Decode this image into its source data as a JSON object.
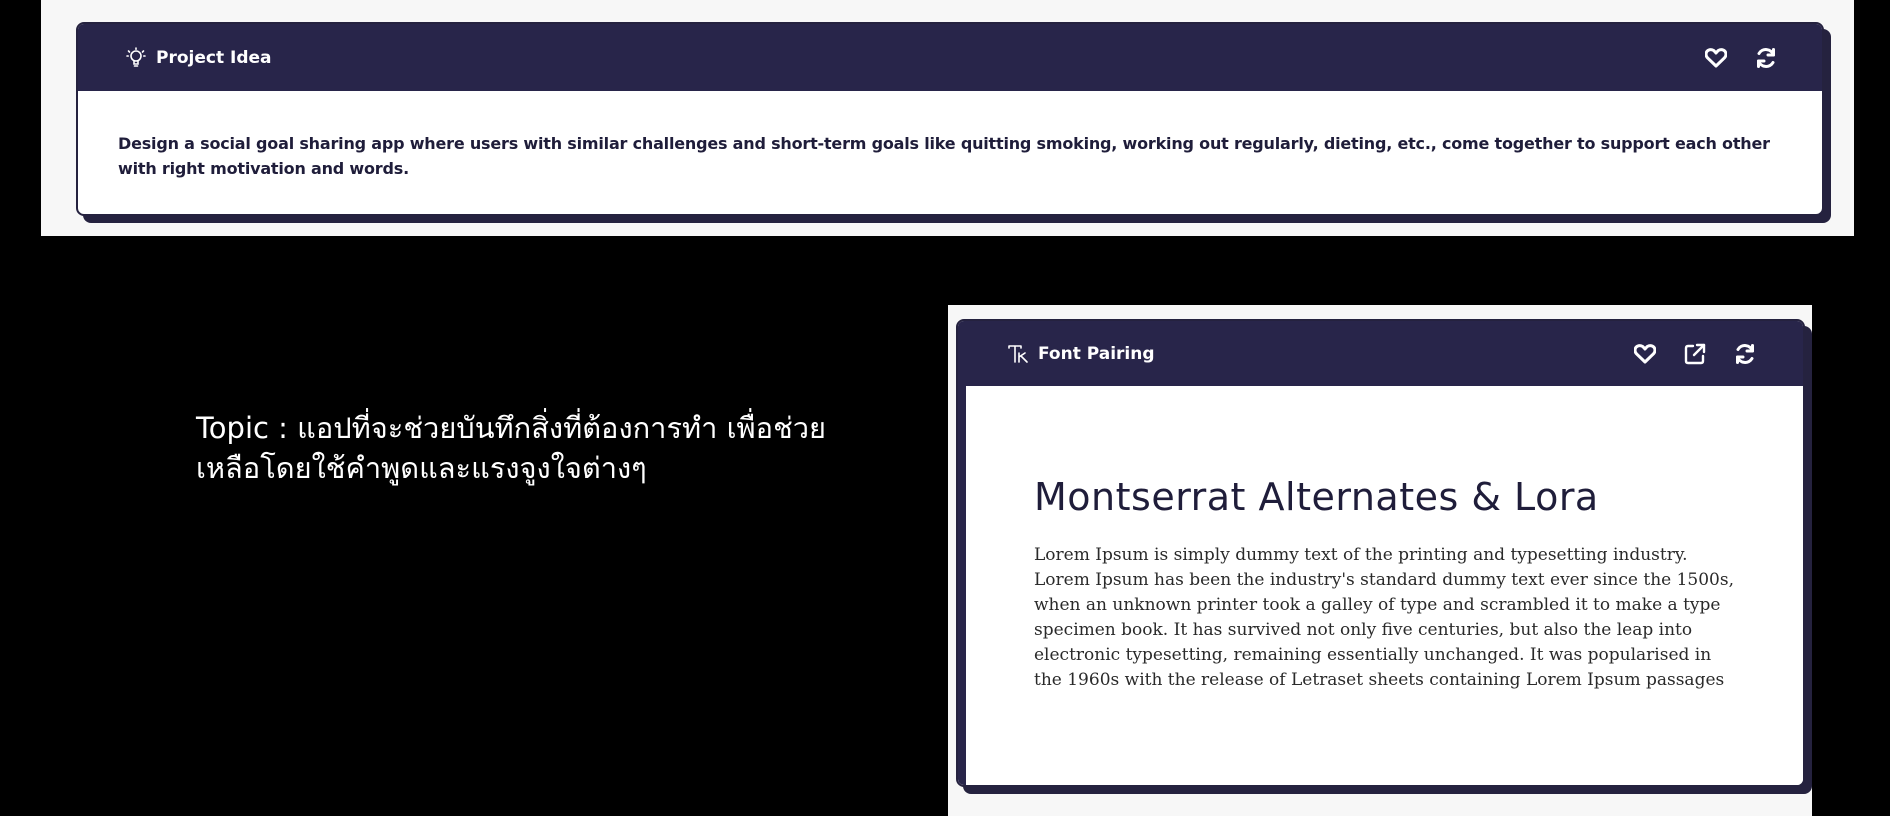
{
  "project_idea": {
    "title": "Project Idea",
    "icon": "lightbulb-icon",
    "text": "Design a social goal sharing app where users with similar challenges and short-term goals like quitting smoking, working out regularly, dieting, etc., come together to support each other with right motivation and words.",
    "actions": [
      "heart-icon",
      "refresh-icon"
    ]
  },
  "topic": {
    "text": "Topic : แอปที่จะช่วยบันทึกสิ่งที่ต้องการทำ เพื่อช่วยเหลือโดยใช้คำพูดและแรงจูงใจต่างๆ"
  },
  "font_pairing": {
    "title": "Font Pairing",
    "icon": "font-icon",
    "heading": "Montserrat Alternates & Lora",
    "body": "Lorem Ipsum is simply dummy text of the printing and typesetting industry. Lorem Ipsum has been the industry's standard dummy text ever since the 1500s, when an unknown printer took a galley of type and scrambled it to make a type specimen book. It has survived not only five centuries, but also the leap into electronic typesetting, remaining essentially unchanged. It was popularised in the 1960s with the release of Letraset sheets containing Lorem Ipsum passages",
    "actions": [
      "heart-icon",
      "external-link-icon",
      "refresh-icon"
    ]
  },
  "colors": {
    "header": "#28254a",
    "panel": "#f7f7f7",
    "background": "#000000",
    "text_dark": "#1f1d3a"
  }
}
